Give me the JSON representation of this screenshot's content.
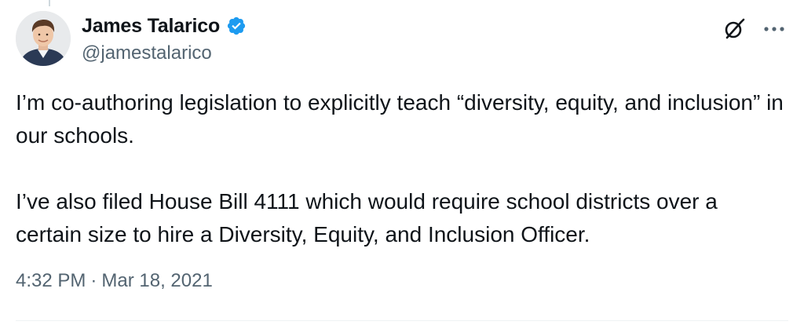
{
  "author": {
    "display_name": "James Talarico",
    "handle": "@jamestalarico",
    "verified": true
  },
  "tweet": {
    "paragraphs": [
      "I’m co-authoring legislation to explicitly teach “diversity, equity, and inclusion” in our schools.",
      "I’ve also filed House Bill 4111 which would require school districts over a certain size to hire a Diversity, Equity, and Inclusion Officer."
    ],
    "time": "4:32 PM",
    "separator": "·",
    "date": "Mar 18, 2021"
  },
  "icons": {
    "verified": "verified-badge-icon",
    "grok": "grok-icon",
    "more": "more-options-icon"
  },
  "colors": {
    "text_primary": "#0f1419",
    "text_secondary": "#536471",
    "verified_blue": "#1d9bf0"
  }
}
